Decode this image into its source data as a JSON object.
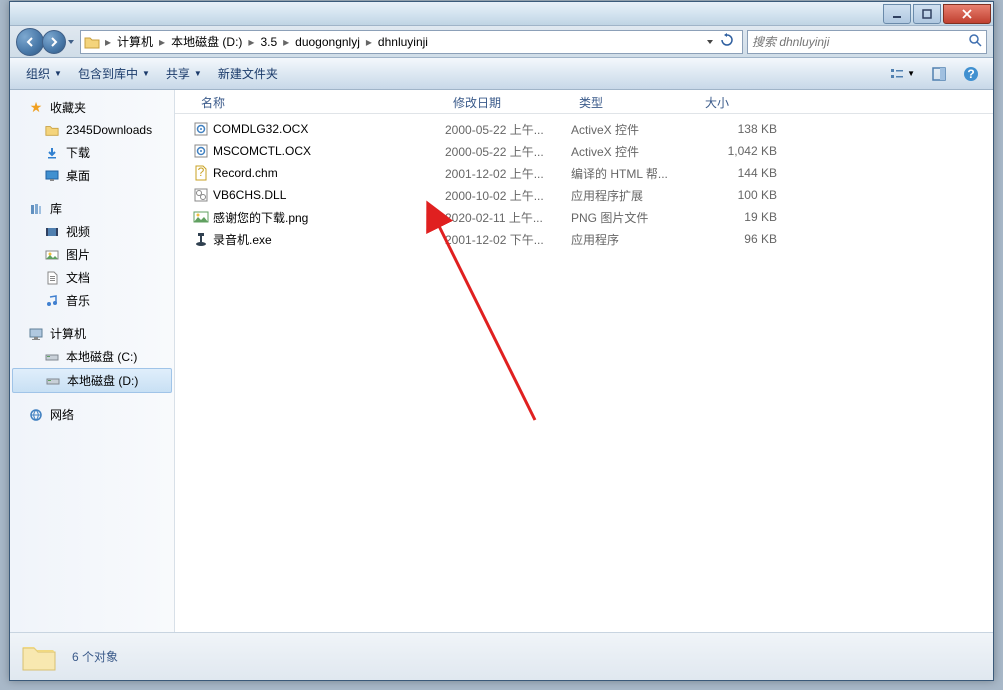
{
  "titlebar": {},
  "breadcrumb": {
    "items": [
      "计算机",
      "本地磁盘 (D:)",
      "3.5",
      "duogongnlyj",
      "dhnluyinji"
    ]
  },
  "search": {
    "placeholder": "搜索 dhnluyinji"
  },
  "toolbar": {
    "organize": "组织",
    "include": "包含到库中",
    "share": "共享",
    "newfolder": "新建文件夹"
  },
  "sidebar": {
    "favorites": {
      "label": "收藏夹",
      "items": [
        "2345Downloads",
        "下载",
        "桌面"
      ]
    },
    "library": {
      "label": "库",
      "items": [
        "视频",
        "图片",
        "文档",
        "音乐"
      ]
    },
    "computer": {
      "label": "计算机",
      "items": [
        "本地磁盘 (C:)",
        "本地磁盘 (D:)"
      ]
    },
    "network": {
      "label": "网络"
    }
  },
  "columns": {
    "name": "名称",
    "date": "修改日期",
    "type": "类型",
    "size": "大小"
  },
  "files": [
    {
      "icon": "ocx",
      "name": "COMDLG32.OCX",
      "date": "2000-05-22 上午...",
      "type": "ActiveX 控件",
      "size": "138 KB"
    },
    {
      "icon": "ocx",
      "name": "MSCOMCTL.OCX",
      "date": "2000-05-22 上午...",
      "type": "ActiveX 控件",
      "size": "1,042 KB"
    },
    {
      "icon": "chm",
      "name": "Record.chm",
      "date": "2001-12-02 上午...",
      "type": "编译的 HTML 帮...",
      "size": "144 KB"
    },
    {
      "icon": "dll",
      "name": "VB6CHS.DLL",
      "date": "2000-10-02 上午...",
      "type": "应用程序扩展",
      "size": "100 KB"
    },
    {
      "icon": "png",
      "name": "感谢您的下载.png",
      "date": "2020-02-11 上午...",
      "type": "PNG 图片文件",
      "size": "19 KB"
    },
    {
      "icon": "exe",
      "name": "录音机.exe",
      "date": "2001-12-02 下午...",
      "type": "应用程序",
      "size": "96 KB"
    }
  ],
  "status": {
    "text": "6 个对象"
  }
}
